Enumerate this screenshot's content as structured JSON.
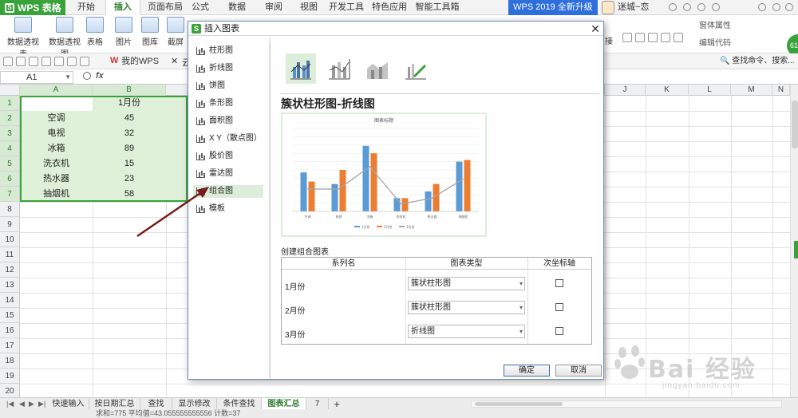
{
  "app": {
    "logo": "WPS 表格",
    "menu": [
      "开始",
      "插入",
      "页面布局",
      "公式",
      "数据",
      "审阅",
      "视图",
      "开发工具",
      "特色应用",
      "智能工具箱"
    ],
    "active_menu": "插入",
    "upgrade": "WPS 2019 全新升级",
    "username": "迷城~恋",
    "badge": "61"
  },
  "ribbon": {
    "pivot_table": "数据透视表",
    "pivot_chart": "数据透视图",
    "table": "表格",
    "picture": "图片",
    "gallery": "图库",
    "screenshot": "截屏",
    "right_items": [
      "窗体属性",
      "编辑代码"
    ],
    "partial_right": "接"
  },
  "quickbar": {
    "doc_tab": "我的WPS",
    "cloud": "云",
    "search_cmd": "查找命令、搜索..."
  },
  "formula": {
    "cell_ref": "A1",
    "fx": "fx"
  },
  "sheet": {
    "columns": [
      "A",
      "B",
      "J",
      "K",
      "L",
      "M",
      "N"
    ],
    "rows": [
      "1",
      "2",
      "3",
      "4",
      "5",
      "6",
      "7",
      "8",
      "9",
      "10",
      "11",
      "12",
      "13",
      "14",
      "15",
      "16",
      "17",
      "18",
      "19",
      "20"
    ],
    "header_b1": "1月份",
    "data": [
      {
        "name": "空调",
        "value": "45"
      },
      {
        "name": "电视",
        "value": "32"
      },
      {
        "name": "冰箱",
        "value": "89"
      },
      {
        "name": "洗衣机",
        "value": "15"
      },
      {
        "name": "热水器",
        "value": "23"
      },
      {
        "name": "抽烟机",
        "value": "58"
      }
    ]
  },
  "sheet_tabs": {
    "tabs": [
      "快速输入",
      "按日期汇总",
      "查找",
      "显示修改",
      "条件查找",
      "图表汇总",
      "7"
    ],
    "active": "图表汇总",
    "add": "+"
  },
  "status": {
    "text": "求和=775  平均值=43.055555555556  计数=37"
  },
  "dialog": {
    "title": "插入图表",
    "chart_types": [
      "柱形图",
      "折线图",
      "饼图",
      "条形图",
      "面积图",
      "X Y（散点图）",
      "股价图",
      "雷达图",
      "组合图",
      "模板"
    ],
    "active_type": "组合图",
    "heading": "簇状柱形图-折线图",
    "preview_title": "图表标题",
    "preview_legend": [
      "1月份",
      "2月份",
      "3月份"
    ],
    "preview_categories": [
      "空调",
      "电视",
      "冰箱",
      "洗衣机",
      "热水器",
      "抽烟机"
    ],
    "combo_title": "创建组合图表",
    "table_headers": [
      "系列名",
      "图表类型",
      "次坐标轴"
    ],
    "series_rows": [
      {
        "name": "1月份",
        "type": "簇状柱形图"
      },
      {
        "name": "2月份",
        "type": "簇状柱形图"
      },
      {
        "name": "3月份",
        "type": "折线图"
      }
    ],
    "ok": "确定",
    "cancel": "取消",
    "colors": {
      "series1": "#5b9bd5",
      "series2": "#ed7d31",
      "series3": "#a5a5a5"
    }
  },
  "watermark": {
    "text": "Bai 经验",
    "url": "jingyan.baidu.com"
  }
}
